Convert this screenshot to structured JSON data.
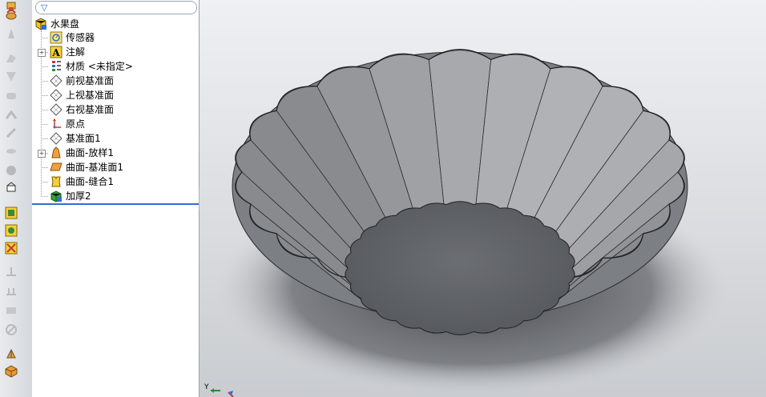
{
  "feature_tree": {
    "filter": {
      "icon": "filter-icon"
    },
    "root": {
      "label": "水果盘",
      "icon": "part-icon"
    },
    "items": [
      {
        "label": "传感器",
        "icon": "sensor-icon",
        "expandable": false
      },
      {
        "label": "注解",
        "icon": "annotation-icon",
        "expandable": true
      },
      {
        "label": "材质 <未指定>",
        "icon": "material-icon",
        "expandable": false
      },
      {
        "label": "前视基准面",
        "icon": "plane-icon",
        "expandable": false
      },
      {
        "label": "上视基准面",
        "icon": "plane-icon",
        "expandable": false
      },
      {
        "label": "右视基准面",
        "icon": "plane-icon",
        "expandable": false
      },
      {
        "label": "原点",
        "icon": "origin-icon",
        "expandable": false
      },
      {
        "label": "基准面1",
        "icon": "plane-icon",
        "expandable": false
      },
      {
        "label": "曲面-放样1",
        "icon": "surface-loft-icon",
        "expandable": true
      },
      {
        "label": "曲面-基准面1",
        "icon": "planar-surface-icon",
        "expandable": false
      },
      {
        "label": "曲面-缝合1",
        "icon": "knit-surface-icon",
        "expandable": false
      },
      {
        "label": "加厚2",
        "icon": "thicken-icon",
        "expandable": false
      }
    ]
  },
  "viewport": {
    "model": "fluted-bowl-model",
    "triad": {
      "y_label": "Y"
    }
  },
  "colors": {
    "accent": "#2f6fd0",
    "model": "#8a8d91"
  }
}
